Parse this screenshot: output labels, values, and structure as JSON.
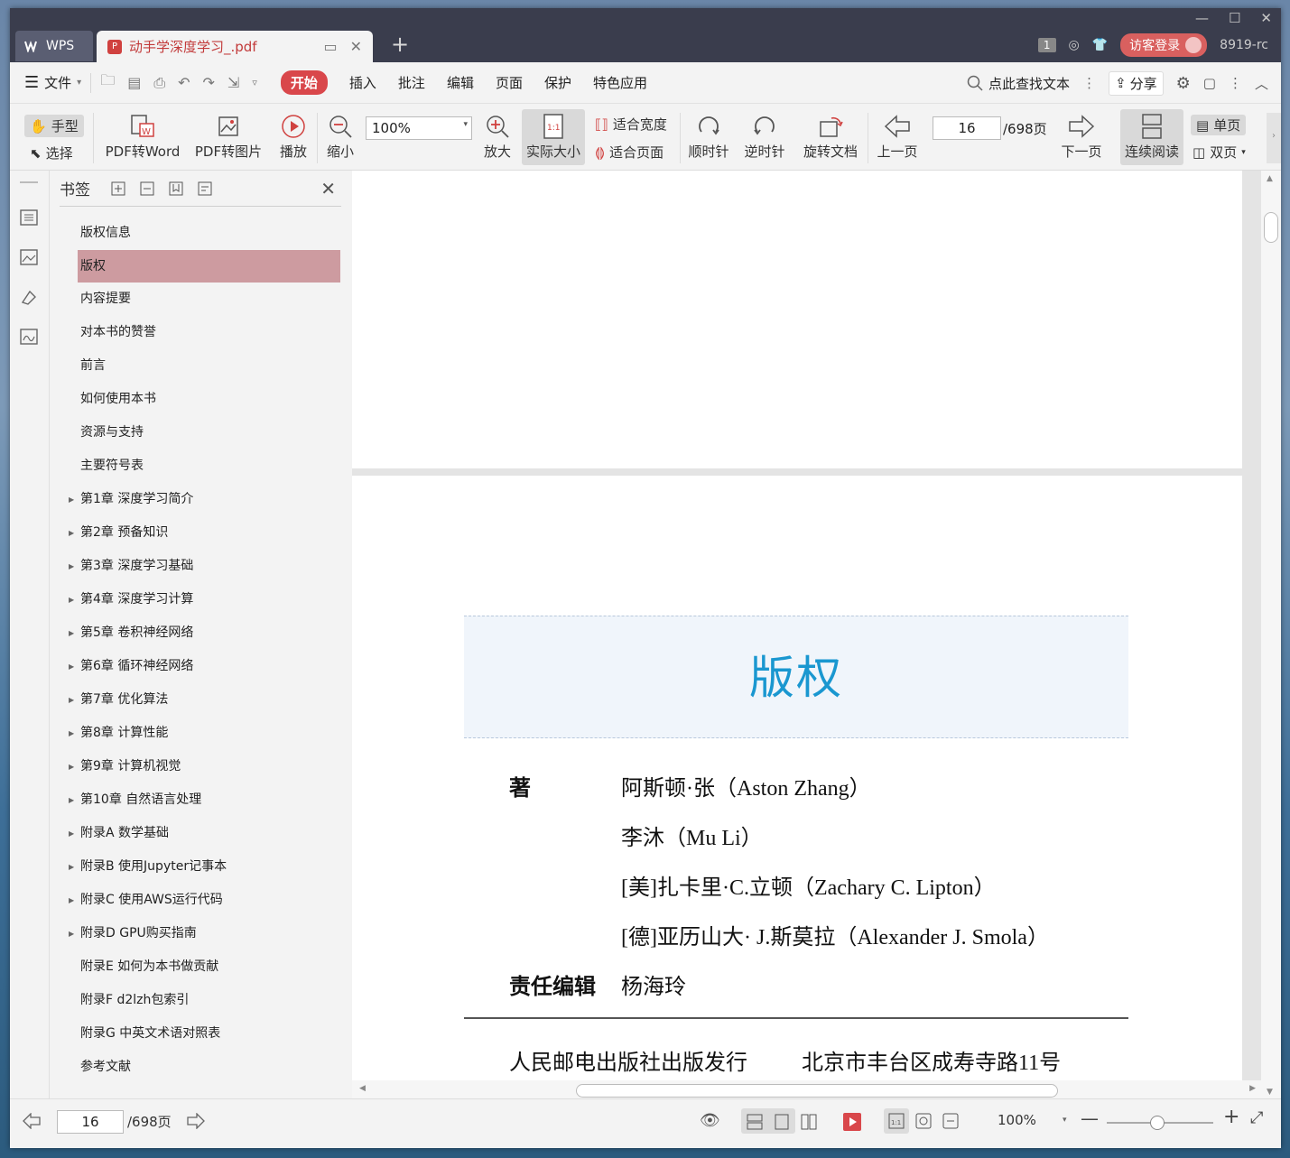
{
  "titlebar": {
    "app_tab": "WPS",
    "doc_tab": "动手学深度学习_.pdf",
    "counter": "1",
    "login": "访客登录",
    "user": "8919-rc"
  },
  "menubar": {
    "file": "文件",
    "tabs": [
      "开始",
      "插入",
      "批注",
      "编辑",
      "页面",
      "保护",
      "特色应用"
    ],
    "search": "点此查找文本",
    "share": "分享"
  },
  "toolbar": {
    "hand": "手型",
    "select": "选择",
    "pdf_word": "PDF转Word",
    "pdf_img": "PDF转图片",
    "play": "播放",
    "zoom_out": "缩小",
    "zoom_value": "100%",
    "zoom_in": "放大",
    "actual_size": "实际大小",
    "fit_width": "适合宽度",
    "fit_page": "适合页面",
    "rotate_cw": "顺时针",
    "rotate_ccw": "逆时针",
    "rotate_doc": "旋转文档",
    "prev_page": "上一页",
    "page_value": "16",
    "page_total": "/698页",
    "next_page": "下一页",
    "continuous": "连续阅读",
    "single": "单页",
    "double": "双页"
  },
  "bookmarks": {
    "title": "书签",
    "items": [
      {
        "label": "版权信息",
        "expandable": false
      },
      {
        "label": "版权",
        "expandable": false,
        "selected": true
      },
      {
        "label": "内容提要",
        "expandable": false
      },
      {
        "label": "对本书的赞誉",
        "expandable": false
      },
      {
        "label": "前言",
        "expandable": false
      },
      {
        "label": "如何使用本书",
        "expandable": false
      },
      {
        "label": "资源与支持",
        "expandable": false
      },
      {
        "label": "主要符号表",
        "expandable": false
      },
      {
        "label": "第1章 深度学习简介",
        "expandable": true
      },
      {
        "label": "第2章 预备知识",
        "expandable": true
      },
      {
        "label": "第3章 深度学习基础",
        "expandable": true
      },
      {
        "label": "第4章 深度学习计算",
        "expandable": true
      },
      {
        "label": "第5章 卷积神经网络",
        "expandable": true
      },
      {
        "label": "第6章 循环神经网络",
        "expandable": true
      },
      {
        "label": "第7章 优化算法",
        "expandable": true
      },
      {
        "label": "第8章 计算性能",
        "expandable": true
      },
      {
        "label": "第9章 计算机视觉",
        "expandable": true
      },
      {
        "label": "第10章 自然语言处理",
        "expandable": true
      },
      {
        "label": "附录A 数学基础",
        "expandable": true
      },
      {
        "label": "附录B 使用Jupyter记事本",
        "expandable": true
      },
      {
        "label": "附录C 使用AWS运行代码",
        "expandable": true
      },
      {
        "label": "附录D GPU购买指南",
        "expandable": true
      },
      {
        "label": "附录E 如何为本书做贡献",
        "expandable": false
      },
      {
        "label": "附录F d2lzh包索引",
        "expandable": false
      },
      {
        "label": "附录G 中英文术语对照表",
        "expandable": false
      },
      {
        "label": "参考文献",
        "expandable": false
      }
    ]
  },
  "document": {
    "heading": "版权",
    "author_label": "著",
    "authors": [
      "阿斯顿·张（Aston Zhang）",
      "李沐（Mu Li）",
      "[美]扎卡里·C.立顿（Zachary C. Lipton）",
      "[德]亚历山大· J.斯莫拉（Alexander J. Smola）"
    ],
    "editor_label": "责任编辑",
    "editor": "杨海玲",
    "publisher": "人民邮电出版社出版发行",
    "address": "北京市丰台区成寿寺路11号"
  },
  "statusbar": {
    "page_value": "16",
    "page_total": "/698页",
    "zoom": "100%"
  },
  "colors": {
    "accent": "#d9474b",
    "title_blue": "#1a97d0",
    "selected_bookmark": "#cd9ba0"
  }
}
